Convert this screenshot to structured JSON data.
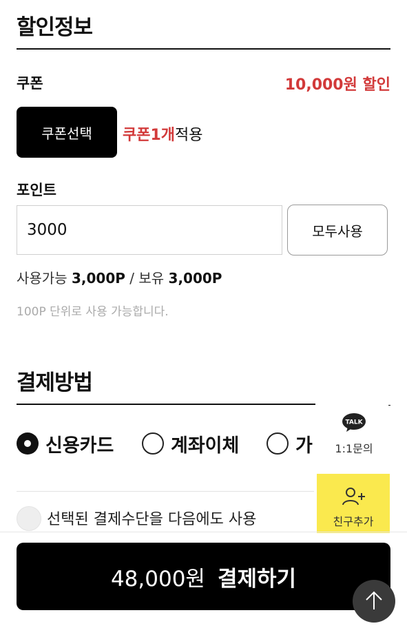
{
  "discount_section": {
    "title": "할인정보",
    "coupon": {
      "label": "쿠폰",
      "discount_amount": "10,000원 할인",
      "select_button": "쿠폰선택",
      "applied_count": "쿠폰1개",
      "applied_suffix": "적용"
    },
    "point": {
      "label": "포인트",
      "input_value": "3000",
      "use_all_button": "모두사용",
      "available_label": "사용가능",
      "available_value": "3,000P",
      "separator": "/",
      "owned_label": "보유",
      "owned_value": "3,000P",
      "note": "100P 단위로 사용 가능합니다."
    }
  },
  "payment_section": {
    "title": "결제방법",
    "methods": [
      {
        "label": "신용카드",
        "selected": true
      },
      {
        "label": "계좌이체",
        "selected": false
      },
      {
        "label": "가",
        "selected": false
      }
    ],
    "remember_label": "선택된 결제수단을 다음에도 사용"
  },
  "floating": {
    "talk_badge": "TALK",
    "talk_label": "1:1문의",
    "friend_label": "친구추가"
  },
  "bottom_bar": {
    "amount": "48,000원",
    "pay_label": "결제하기"
  },
  "icons": {
    "top": "arrow-up-icon",
    "friend": "person-add-icon",
    "talk": "talk-bubble-icon"
  },
  "colors": {
    "accent_red": "#d23a3a",
    "kakao_yellow": "#fae94e",
    "primary_black": "#000000"
  }
}
